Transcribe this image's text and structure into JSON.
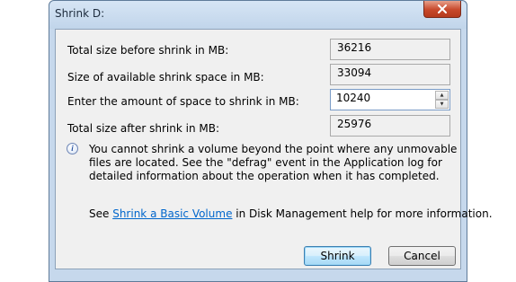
{
  "window": {
    "title": "Shrink D:"
  },
  "fields": [
    {
      "label": "Total size before shrink in MB:",
      "value": "36216"
    },
    {
      "label": "Size of available shrink space in MB:",
      "value": "33094"
    },
    {
      "label": "Enter the amount of space to shrink in MB:",
      "value": "10240"
    },
    {
      "label": "Total size after shrink in MB:",
      "value": "25976"
    }
  ],
  "info": {
    "icon": "info-icon",
    "text": "You cannot shrink a volume beyond the point where any unmovable files are located. See the \"defrag\" event in the Application log for detailed information about the operation when it has completed."
  },
  "help": {
    "prefix": "See ",
    "link": "Shrink a Basic Volume",
    "suffix": " in Disk Management help for more information."
  },
  "buttons": {
    "shrink": "Shrink",
    "cancel": "Cancel"
  },
  "colors": {
    "link": "#0066cc",
    "close_button": "#c7482a",
    "default_button_border": "#3c7fb1"
  }
}
